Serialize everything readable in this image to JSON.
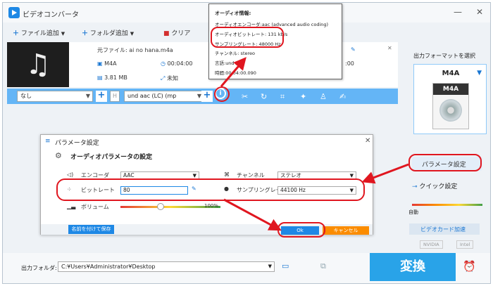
{
  "app": {
    "title": "ビデオコンバータ"
  },
  "window_controls": {
    "minimize": "—",
    "close": "✕"
  },
  "toolbar": {
    "add_file": "ファイル追加",
    "add_folder": "フォルダ追加",
    "clear": "クリア"
  },
  "file": {
    "source_label": "元ファイル: ai no hana.m4a",
    "format": "M4A",
    "duration": "00:04:00",
    "size": "3.81 MB",
    "resolution": "未知",
    "dest_duration": ":00"
  },
  "bar": {
    "subtitle": "なし",
    "audio_track": "und aac (LC) (mp"
  },
  "popup": {
    "title": "オーディオ情報:",
    "encoder": "オーディオエンコーダ:aac (advanced audio coding)",
    "bitrate": "オーディオビットレート: 131 kb/s",
    "samplerate": "サンプリングレート: 48000 Hz",
    "channels": "チャンネル: stereo",
    "language": "言語:und",
    "duration": "時間:00:04:00.090"
  },
  "dialog": {
    "title": "パラメータ設定",
    "section": "オーディオパラメータの設定",
    "encoder_label": "エンコーダ",
    "encoder_value": "AAC",
    "channel_label": "チャンネル",
    "channel_value": "ステレオ",
    "bitrate_label": "ビットレート",
    "bitrate_value": "80",
    "samplerate_label": "サンプリングレート",
    "samplerate_value": "44100 Hz",
    "volume_label": "ボリューム",
    "volume_value": "100%",
    "save_as": "名前を付けて保存",
    "ok": "Ok",
    "cancel": "キャンセル"
  },
  "right_panel": {
    "select_format": "出力フォーマットを選択",
    "format": "M4A",
    "format_tag": "M4A",
    "param_settings": "パラメータ設定",
    "quick_settings": "クイック設定",
    "auto": "自動",
    "gpu_accel": "ビデオカード加速",
    "nvidia": "NVIDIA",
    "intel": "Intel"
  },
  "bottom": {
    "output_label": "出力フォルダ:",
    "output_path": "C:¥Users¥Administrator¥Desktop",
    "convert": "変換"
  },
  "colors": {
    "accent": "#29a3e8",
    "highlight": "#e0161f",
    "cancel": "#fb8c00"
  }
}
